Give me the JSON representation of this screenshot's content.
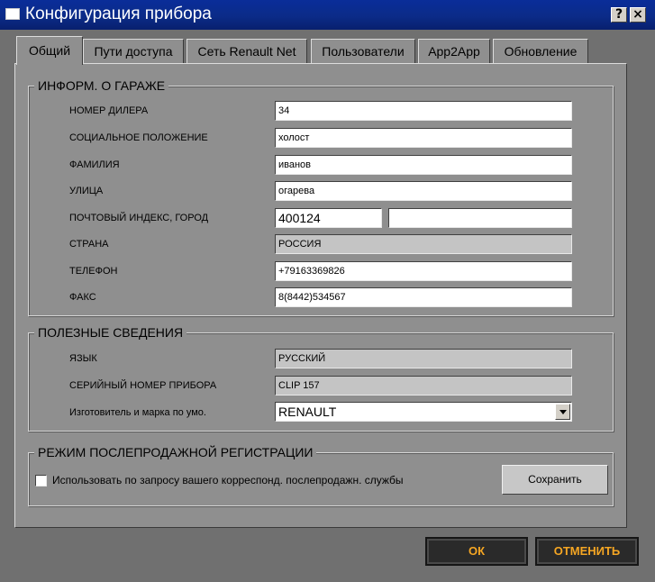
{
  "window": {
    "title": "Конфигурация прибора",
    "help_label": "?",
    "close_label": "×"
  },
  "tabs": [
    {
      "label": "Общий",
      "active": true
    },
    {
      "label": "Пути доступа"
    },
    {
      "label": "Сеть Renault Net"
    },
    {
      "label": "Пользователи"
    },
    {
      "label": "App2App"
    },
    {
      "label": "Обновление"
    }
  ],
  "garage": {
    "legend": "ИНФОРМ. О ГАРАЖЕ",
    "dealer_label": "НОМЕР ДИЛЕРА",
    "dealer_value": "34",
    "social_label": "СОЦИАЛЬНОЕ ПОЛОЖЕНИЕ",
    "social_value": "холост",
    "surname_label": "ФАМИЛИЯ",
    "surname_value": "иванов",
    "street_label": "УЛИЦА",
    "street_value": "огарева",
    "postcode_label": "ПОЧТОВЫЙ ИНДЕКС, ГОРОД",
    "postcode_value": "400124",
    "city_value": "",
    "country_label": "СТРАНА",
    "country_value": "РОССИЯ",
    "phone_label": "ТЕЛЕФОН",
    "phone_value": "+79163369826",
    "fax_label": "ФАКС",
    "fax_value": "8(8442)534567"
  },
  "useful": {
    "legend": "ПОЛЕЗНЫЕ СВЕДЕНИЯ",
    "language_label": "ЯЗЫК",
    "language_value": "РУССКИЙ",
    "serial_label": "СЕРИЙНЫЙ НОМЕР ПРИБОРА",
    "serial_value": "CLIP 157",
    "maker_label": "Изготовитель и марка по умо.",
    "maker_value": "RENAULT"
  },
  "aftersales": {
    "legend": "РЕЖИМ ПОСЛЕПРОДАЖНОЙ РЕГИСТРАЦИИ",
    "checkbox_label": "Использовать по запросу вашего корреспонд. послепродажн. службы",
    "checkbox_checked": false,
    "save_label": "Сохранить"
  },
  "footer": {
    "ok_label": "ОК",
    "cancel_label": "ОТМЕНИТЬ"
  },
  "colors": {
    "title_bar": "#0b2b88",
    "dialog_bg": "#8f8f8f",
    "button_text_accent": "#f5a623"
  }
}
